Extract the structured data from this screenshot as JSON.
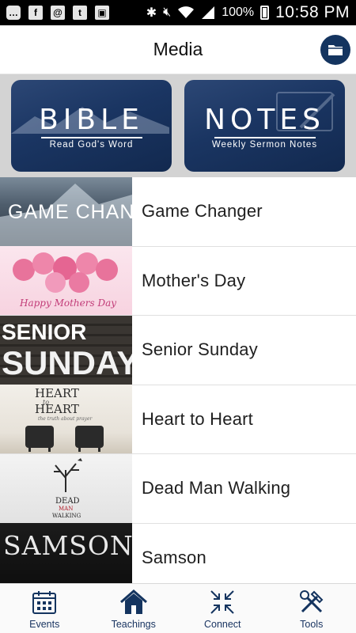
{
  "status_bar": {
    "battery": "100%",
    "time": "10:58 PM"
  },
  "header": {
    "title": "Media"
  },
  "cards": [
    {
      "title": "BIBLE",
      "subtitle": "Read God's Word"
    },
    {
      "title": "NOTES",
      "subtitle": "Weekly Sermon Notes"
    }
  ],
  "series": [
    {
      "label": "Game Changer",
      "thumb_text": "GAME CHANGER"
    },
    {
      "label": "Mother's Day",
      "thumb_text": "Happy Mothers Day"
    },
    {
      "label": "Senior Sunday",
      "thumb_text": "SENIOR SUNDAY"
    },
    {
      "label": "Heart to Heart",
      "thumb_text": "HEART to HEART",
      "thumb_sub": "the truth about prayer"
    },
    {
      "label": "Dead Man Walking",
      "thumb_text": "DEAD MAN WALKING"
    },
    {
      "label": "Samson",
      "thumb_text": "SAMSON"
    }
  ],
  "nav": [
    {
      "label": "Events",
      "icon": "calendar-icon"
    },
    {
      "label": "Teachings",
      "icon": "house-icon"
    },
    {
      "label": "Connect",
      "icon": "arrows-inward-icon"
    },
    {
      "label": "Tools",
      "icon": "tools-icon"
    }
  ],
  "colors": {
    "brand": "#14345f",
    "card_bg": "#1a3562",
    "divider": "#e0e0e0"
  }
}
